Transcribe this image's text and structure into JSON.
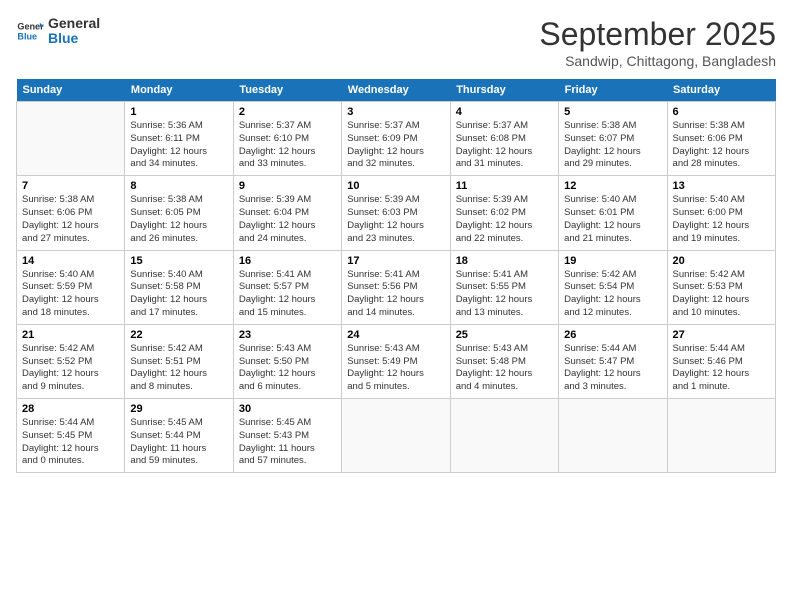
{
  "logo": {
    "line1": "General",
    "line2": "Blue"
  },
  "title": "September 2025",
  "subtitle": "Sandwip, Chittagong, Bangladesh",
  "days_of_week": [
    "Sunday",
    "Monday",
    "Tuesday",
    "Wednesday",
    "Thursday",
    "Friday",
    "Saturday"
  ],
  "weeks": [
    [
      {
        "day": "",
        "info": ""
      },
      {
        "day": "1",
        "info": "Sunrise: 5:36 AM\nSunset: 6:11 PM\nDaylight: 12 hours\nand 34 minutes."
      },
      {
        "day": "2",
        "info": "Sunrise: 5:37 AM\nSunset: 6:10 PM\nDaylight: 12 hours\nand 33 minutes."
      },
      {
        "day": "3",
        "info": "Sunrise: 5:37 AM\nSunset: 6:09 PM\nDaylight: 12 hours\nand 32 minutes."
      },
      {
        "day": "4",
        "info": "Sunrise: 5:37 AM\nSunset: 6:08 PM\nDaylight: 12 hours\nand 31 minutes."
      },
      {
        "day": "5",
        "info": "Sunrise: 5:38 AM\nSunset: 6:07 PM\nDaylight: 12 hours\nand 29 minutes."
      },
      {
        "day": "6",
        "info": "Sunrise: 5:38 AM\nSunset: 6:06 PM\nDaylight: 12 hours\nand 28 minutes."
      }
    ],
    [
      {
        "day": "7",
        "info": "Sunrise: 5:38 AM\nSunset: 6:06 PM\nDaylight: 12 hours\nand 27 minutes."
      },
      {
        "day": "8",
        "info": "Sunrise: 5:38 AM\nSunset: 6:05 PM\nDaylight: 12 hours\nand 26 minutes."
      },
      {
        "day": "9",
        "info": "Sunrise: 5:39 AM\nSunset: 6:04 PM\nDaylight: 12 hours\nand 24 minutes."
      },
      {
        "day": "10",
        "info": "Sunrise: 5:39 AM\nSunset: 6:03 PM\nDaylight: 12 hours\nand 23 minutes."
      },
      {
        "day": "11",
        "info": "Sunrise: 5:39 AM\nSunset: 6:02 PM\nDaylight: 12 hours\nand 22 minutes."
      },
      {
        "day": "12",
        "info": "Sunrise: 5:40 AM\nSunset: 6:01 PM\nDaylight: 12 hours\nand 21 minutes."
      },
      {
        "day": "13",
        "info": "Sunrise: 5:40 AM\nSunset: 6:00 PM\nDaylight: 12 hours\nand 19 minutes."
      }
    ],
    [
      {
        "day": "14",
        "info": "Sunrise: 5:40 AM\nSunset: 5:59 PM\nDaylight: 12 hours\nand 18 minutes."
      },
      {
        "day": "15",
        "info": "Sunrise: 5:40 AM\nSunset: 5:58 PM\nDaylight: 12 hours\nand 17 minutes."
      },
      {
        "day": "16",
        "info": "Sunrise: 5:41 AM\nSunset: 5:57 PM\nDaylight: 12 hours\nand 15 minutes."
      },
      {
        "day": "17",
        "info": "Sunrise: 5:41 AM\nSunset: 5:56 PM\nDaylight: 12 hours\nand 14 minutes."
      },
      {
        "day": "18",
        "info": "Sunrise: 5:41 AM\nSunset: 5:55 PM\nDaylight: 12 hours\nand 13 minutes."
      },
      {
        "day": "19",
        "info": "Sunrise: 5:42 AM\nSunset: 5:54 PM\nDaylight: 12 hours\nand 12 minutes."
      },
      {
        "day": "20",
        "info": "Sunrise: 5:42 AM\nSunset: 5:53 PM\nDaylight: 12 hours\nand 10 minutes."
      }
    ],
    [
      {
        "day": "21",
        "info": "Sunrise: 5:42 AM\nSunset: 5:52 PM\nDaylight: 12 hours\nand 9 minutes."
      },
      {
        "day": "22",
        "info": "Sunrise: 5:42 AM\nSunset: 5:51 PM\nDaylight: 12 hours\nand 8 minutes."
      },
      {
        "day": "23",
        "info": "Sunrise: 5:43 AM\nSunset: 5:50 PM\nDaylight: 12 hours\nand 6 minutes."
      },
      {
        "day": "24",
        "info": "Sunrise: 5:43 AM\nSunset: 5:49 PM\nDaylight: 12 hours\nand 5 minutes."
      },
      {
        "day": "25",
        "info": "Sunrise: 5:43 AM\nSunset: 5:48 PM\nDaylight: 12 hours\nand 4 minutes."
      },
      {
        "day": "26",
        "info": "Sunrise: 5:44 AM\nSunset: 5:47 PM\nDaylight: 12 hours\nand 3 minutes."
      },
      {
        "day": "27",
        "info": "Sunrise: 5:44 AM\nSunset: 5:46 PM\nDaylight: 12 hours\nand 1 minute."
      }
    ],
    [
      {
        "day": "28",
        "info": "Sunrise: 5:44 AM\nSunset: 5:45 PM\nDaylight: 12 hours\nand 0 minutes."
      },
      {
        "day": "29",
        "info": "Sunrise: 5:45 AM\nSunset: 5:44 PM\nDaylight: 11 hours\nand 59 minutes."
      },
      {
        "day": "30",
        "info": "Sunrise: 5:45 AM\nSunset: 5:43 PM\nDaylight: 11 hours\nand 57 minutes."
      },
      {
        "day": "",
        "info": ""
      },
      {
        "day": "",
        "info": ""
      },
      {
        "day": "",
        "info": ""
      },
      {
        "day": "",
        "info": ""
      }
    ]
  ]
}
